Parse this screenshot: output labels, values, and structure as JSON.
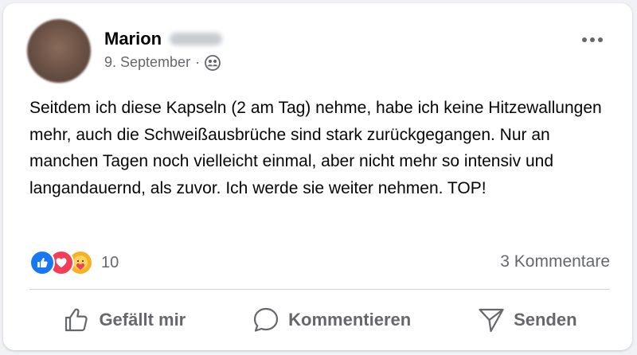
{
  "post": {
    "author_name": "Marion",
    "date": "9. September",
    "separator": "·",
    "audience_icon": "friends-icon",
    "more_icon": "more-dots-icon",
    "text": "Seitdem ich diese Kapseln (2 am Tag) nehme, habe ich keine Hitzewallungen mehr, auch die Schweißausbrüche sind stark zurückgegangen. Nur an manchen Tagen noch vielleicht einmal, aber nicht mehr so intensiv und langandauernd, als zuvor. Ich werde sie weiter nehmen. TOP!"
  },
  "reactions": {
    "types": [
      "like",
      "love",
      "care"
    ],
    "count": "10",
    "colors": {
      "like": "#1877f2",
      "love": "#f33e58",
      "care": "#f7b125"
    }
  },
  "comments_count_label": "3 Kommentare",
  "actions": {
    "like_label": "Gefällt mir",
    "comment_label": "Kommentieren",
    "send_label": "Senden"
  },
  "colors": {
    "text_primary": "#050505",
    "text_secondary": "#65676b",
    "divider": "#ced0d4",
    "background": "#f0f2f5"
  }
}
